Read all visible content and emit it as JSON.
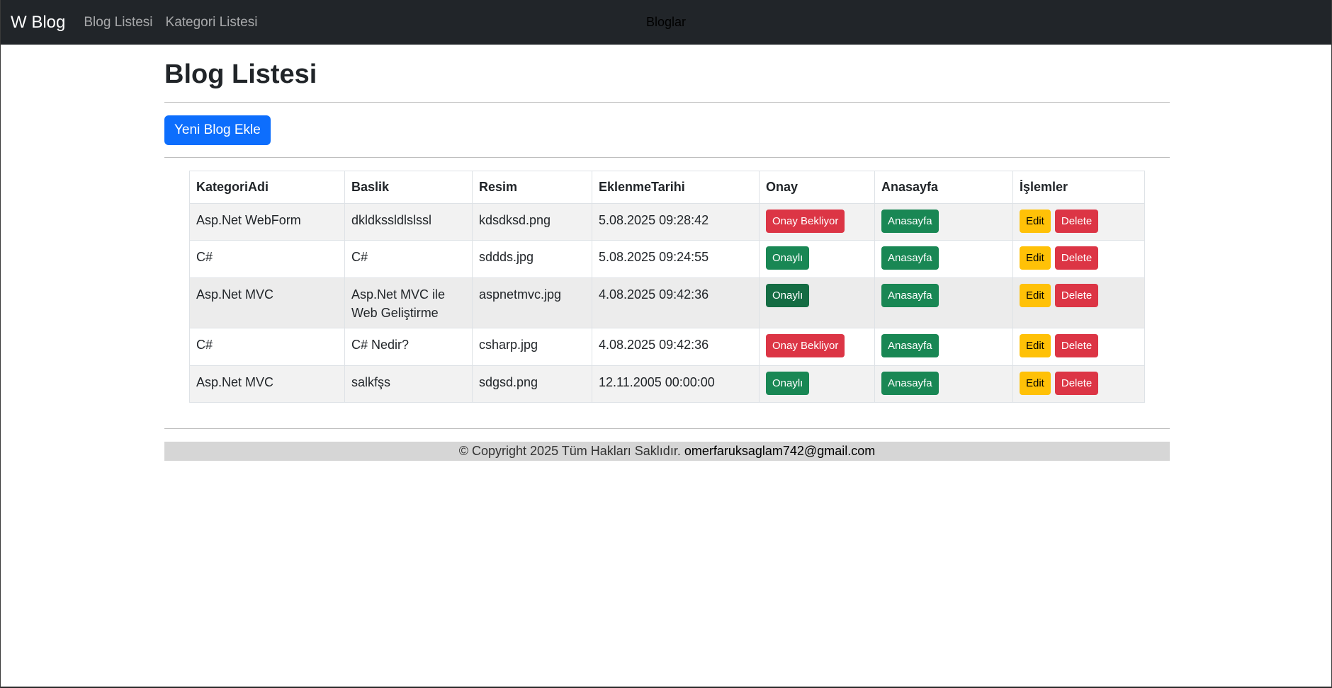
{
  "navbar": {
    "brand": "W Blog",
    "links": [
      "Blog Listesi",
      "Kategori Listesi"
    ],
    "center_text": "Bloglar"
  },
  "page": {
    "title": "Blog Listesi",
    "add_button": "Yeni Blog Ekle"
  },
  "table": {
    "headers": [
      "KategoriAdi",
      "Baslik",
      "Resim",
      "EklenmeTarihi",
      "Onay",
      "Anasayfa",
      "İşlemler"
    ],
    "rows": [
      {
        "kategori": "Asp.Net WebForm",
        "baslik": "dkldkssldlslssl",
        "resim": "kdsdksd.png",
        "tarih": "5.08.2025 09:28:42",
        "onay": "Onay Bekliyor",
        "anasayfa": "Anasayfa",
        "edit": "Edit",
        "delete": "Delete"
      },
      {
        "kategori": "C#",
        "baslik": "C#",
        "resim": "sddds.jpg",
        "tarih": "5.08.2025 09:24:55",
        "onay": "Onaylı",
        "anasayfa": "Anasayfa",
        "edit": "Edit",
        "delete": "Delete"
      },
      {
        "kategori": "Asp.Net MVC",
        "baslik": "Asp.Net MVC ile Web Geliştirme",
        "resim": "aspnetmvc.jpg",
        "tarih": "4.08.2025 09:42:36",
        "onay": "Onaylı",
        "anasayfa": "Anasayfa",
        "edit": "Edit",
        "delete": "Delete"
      },
      {
        "kategori": "C#",
        "baslik": "C# Nedir?",
        "resim": "csharp.jpg",
        "tarih": "4.08.2025 09:42:36",
        "onay": "Onay Bekliyor",
        "anasayfa": "Anasayfa",
        "edit": "Edit",
        "delete": "Delete"
      },
      {
        "kategori": "Asp.Net MVC",
        "baslik": "salkfşs",
        "resim": "sdgsd.png",
        "tarih": "12.11.2005 00:00:00",
        "onay": "Onaylı",
        "anasayfa": "Anasayfa",
        "edit": "Edit",
        "delete": "Delete"
      }
    ]
  },
  "footer": {
    "copyright": "© Copyright 2025 Tüm Hakları Saklıdır.",
    "email": "omerfaruksaglam742@gmail.com"
  },
  "colors": {
    "navbar_bg": "#212529",
    "primary": "#0d6efd",
    "danger": "#dc3545",
    "success": "#198754",
    "warning": "#ffc107"
  }
}
